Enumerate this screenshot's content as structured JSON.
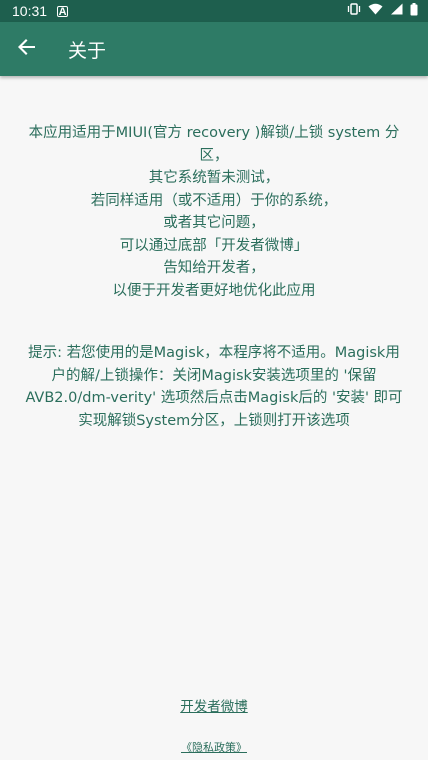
{
  "status_bar": {
    "time": "10:31",
    "notif_letter": "A",
    "icons": [
      "vibrate-icon",
      "wifi-icon",
      "signal-icon",
      "battery-icon"
    ]
  },
  "toolbar": {
    "back_icon": "arrow-back-icon",
    "title": "关于"
  },
  "intro_lines": [
    "本应用适用于MIUI(官方 recovery )解锁/上锁 system 分区，",
    "其它系统暂未测试，",
    "若同样适用（或不适用）于你的系统，",
    "或者其它问题，",
    "可以通过底部「开发者微博」",
    "告知给开发者，",
    "以便于开发者更好地优化此应用"
  ],
  "tip_text": "提示: 若您使用的是Magisk，本程序将不适用。Magisk用户的解/上锁操作：关闭Magisk安装选项里的 '保留AVB2.0/dm-verity' 选项然后点击Magisk后的 '安装' 即可实现解锁System分区，上锁则打开该选项",
  "links": {
    "developer_weibo": "开发者微博",
    "privacy_policy": "《隐私政策》"
  },
  "colors": {
    "status_bar": "#1e5f4e",
    "toolbar": "#2e7b66",
    "text_accent": "#2b6e5c",
    "background": "#f7f7f7"
  }
}
